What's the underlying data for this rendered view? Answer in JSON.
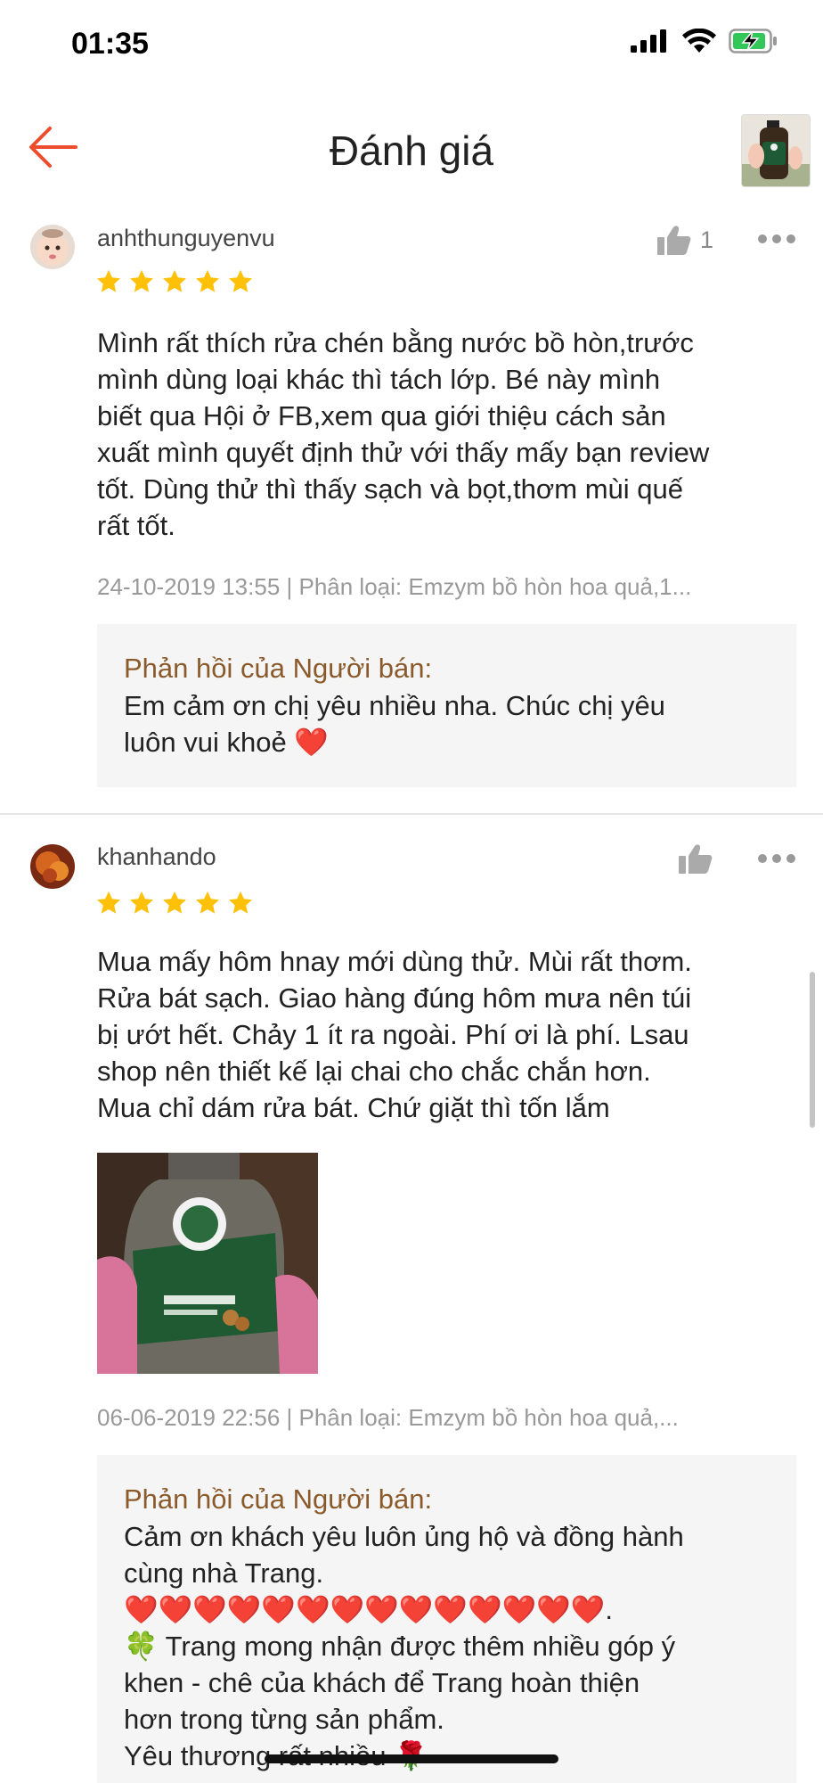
{
  "status": {
    "time": "01:35"
  },
  "header": {
    "title": "Đánh giá"
  },
  "colors": {
    "accent": "#ee4d2d",
    "star": "#ffc107",
    "reply_title": "#8b5a2b",
    "heart": "#e0101a"
  },
  "reviews": [
    {
      "username": "anhthunguyenvu",
      "likes": "1",
      "rating": 5,
      "comment_lines": [
        "Mình rất thích rửa chén bằng nước bồ hòn,trước",
        "mình dùng loại khác thì tách lớp. Bé này mình",
        "biết qua Hội ở FB,xem qua giới thiệu cách sản",
        "xuất mình quyết định thử với thấy mấy bạn review",
        "tốt. Dùng thử thì thấy sạch và bọt,thơm mùi quế",
        "rất tốt."
      ],
      "meta": "24-10-2019 13:55 | Phân loại: Emzym bồ hòn hoa quả,1...",
      "reply_title": "Phản hồi của Người bán:",
      "reply_lines": [
        "Em cảm ơn chị yêu nhiều nha. Chúc chị yêu",
        "luôn vui khoẻ ❤️"
      ]
    },
    {
      "username": "khanhando",
      "likes": "",
      "rating": 5,
      "comment_lines": [
        "Mua mấy hôm hnay mới dùng thử. Mùi rất thơm.",
        "Rửa bát sạch. Giao hàng đúng hôm mưa nên túi",
        "bị ướt hết. Chảy 1 ít ra ngoài. Phí ơi là phí. Lsau",
        "shop nên thiết kế lại chai cho chắc chắn hơn.",
        "Mua chỉ dám rửa bát. Chứ giặt thì tốn lắm"
      ],
      "meta": "06-06-2019 22:56 | Phân loại: Emzym bồ hòn hoa quả,...",
      "reply_title": "Phản hồi của Người bán:",
      "reply_lines": [
        "Cảm ơn khách yêu luôn ủng hộ và đồng hành",
        "cùng nhà Trang.",
        "❤️❤️❤️❤️❤️❤️❤️❤️❤️❤️❤️❤️❤️❤️.",
        "🍀 Trang mong nhận được thêm nhiều góp ý",
        "khen - chê của khách để Trang hoàn thiện",
        "hơn trong từng sản phẩm.",
        "Yêu thương rất nhiều 🌹"
      ]
    }
  ]
}
